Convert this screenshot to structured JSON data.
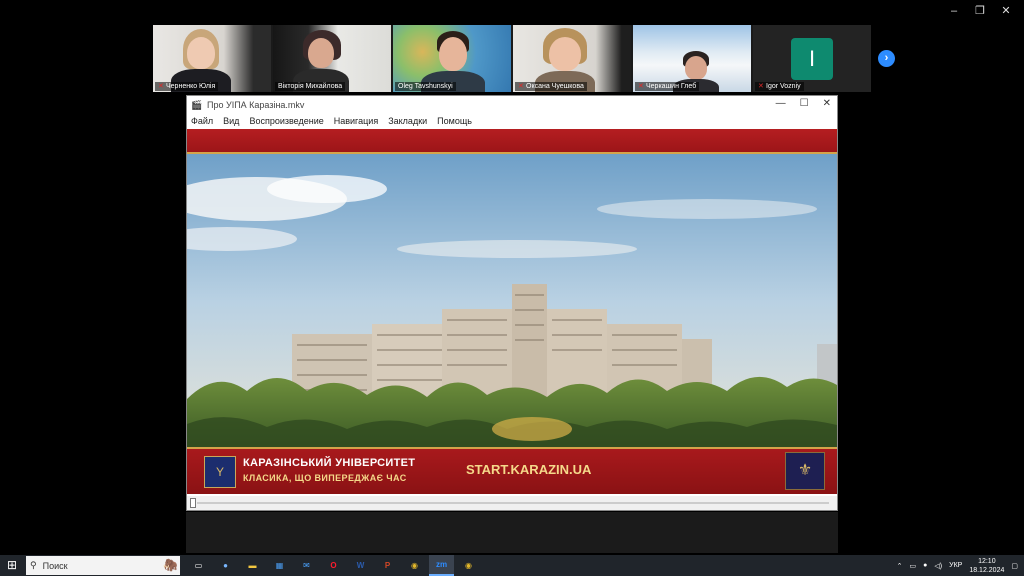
{
  "window_controls": {
    "minimize": "–",
    "restore": "❐",
    "close": "✕"
  },
  "participants": [
    {
      "name": "Черненко Юлія",
      "muted": true
    },
    {
      "name": "Вікторія Михайлова",
      "muted": false
    },
    {
      "name": "Oleg Tavshunskyi",
      "muted": false,
      "active_speaker": true
    },
    {
      "name": "Оксана Чуешкова",
      "muted": true
    },
    {
      "name": "Черкашин Глеб",
      "muted": true
    },
    {
      "name": "Igor Vozniy",
      "muted": true,
      "initial": "I"
    }
  ],
  "next_page_glyph": "›",
  "player": {
    "title": "Про УІПА Каразіна.mkv",
    "title_buttons": {
      "minimize": "—",
      "maximize": "☐",
      "close": "✕"
    },
    "menu": [
      "Файл",
      "Вид",
      "Воспроизведение",
      "Навигация",
      "Закладки",
      "Помощь"
    ],
    "video_overlay": {
      "university_name": "КАРАЗІНСЬКИЙ УНІВЕРСИТЕТ",
      "slogan": "КЛАСИКА, ЩО ВИПЕРЕДЖАЄ ЧАС",
      "website": "START.KARAZIN.UA"
    },
    "seek_progress": 0.0
  },
  "taskbar": {
    "search_placeholder": "Поиск",
    "apps": [
      {
        "name": "task-view",
        "glyph": "▭",
        "color": "#ffffff"
      },
      {
        "name": "copilot",
        "glyph": "●",
        "color": "#7ab8ff"
      },
      {
        "name": "file-explorer",
        "glyph": "▬",
        "color": "#f2c640"
      },
      {
        "name": "store",
        "glyph": "▦",
        "color": "#4a9cf0"
      },
      {
        "name": "mail",
        "glyph": "✉",
        "color": "#4aa3ff"
      },
      {
        "name": "opera",
        "glyph": "O",
        "color": "#ff1b2d"
      },
      {
        "name": "word",
        "glyph": "W",
        "color": "#2b5cad"
      },
      {
        "name": "powerpoint",
        "glyph": "P",
        "color": "#d24726"
      },
      {
        "name": "chrome",
        "glyph": "◉",
        "color": "#e2b72a"
      },
      {
        "name": "zoom",
        "glyph": "zm",
        "color": "#2d8cff",
        "active": true
      },
      {
        "name": "chrome-2",
        "glyph": "◉",
        "color": "#e2b72a"
      }
    ],
    "tray": {
      "language": "УКР",
      "time": "12:10",
      "date": "18.12.2024"
    }
  }
}
